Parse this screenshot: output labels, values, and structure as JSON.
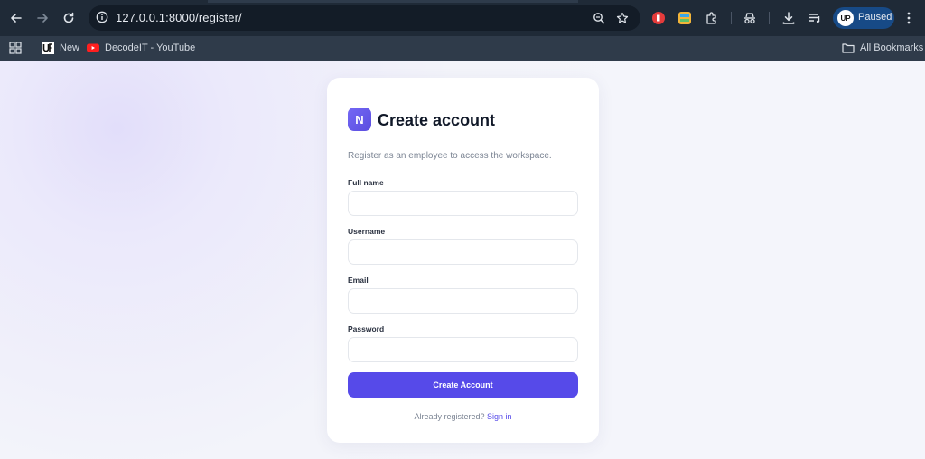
{
  "browser": {
    "url": "127.0.0.1:8000/register/",
    "profile_status": "Paused",
    "profile_initials": "UP"
  },
  "bookmarks": {
    "items": [
      {
        "label": "New",
        "icon": "uf-favicon"
      },
      {
        "label": "DecodeIT - YouTube",
        "icon": "youtube-icon"
      }
    ],
    "all_label": "All Bookmarks"
  },
  "card": {
    "logo_letter": "N",
    "title": "Create account",
    "subtitle": "Register as an employee to access the workspace.",
    "fields": [
      {
        "label": "Full name",
        "value": "",
        "placeholder": ""
      },
      {
        "label": "Username",
        "value": "",
        "placeholder": ""
      },
      {
        "label": "Email",
        "value": "",
        "placeholder": ""
      },
      {
        "label": "Password",
        "value": "",
        "placeholder": ""
      }
    ],
    "submit_label": "Create Account",
    "footer_text": "Already registered?",
    "footer_link": "Sign in"
  },
  "colors": {
    "accent": "#564ae9",
    "chrome_bg": "#1f2a37",
    "bookmarks_bg": "#2f3b4a",
    "page_bg": "#f4f5fb"
  }
}
